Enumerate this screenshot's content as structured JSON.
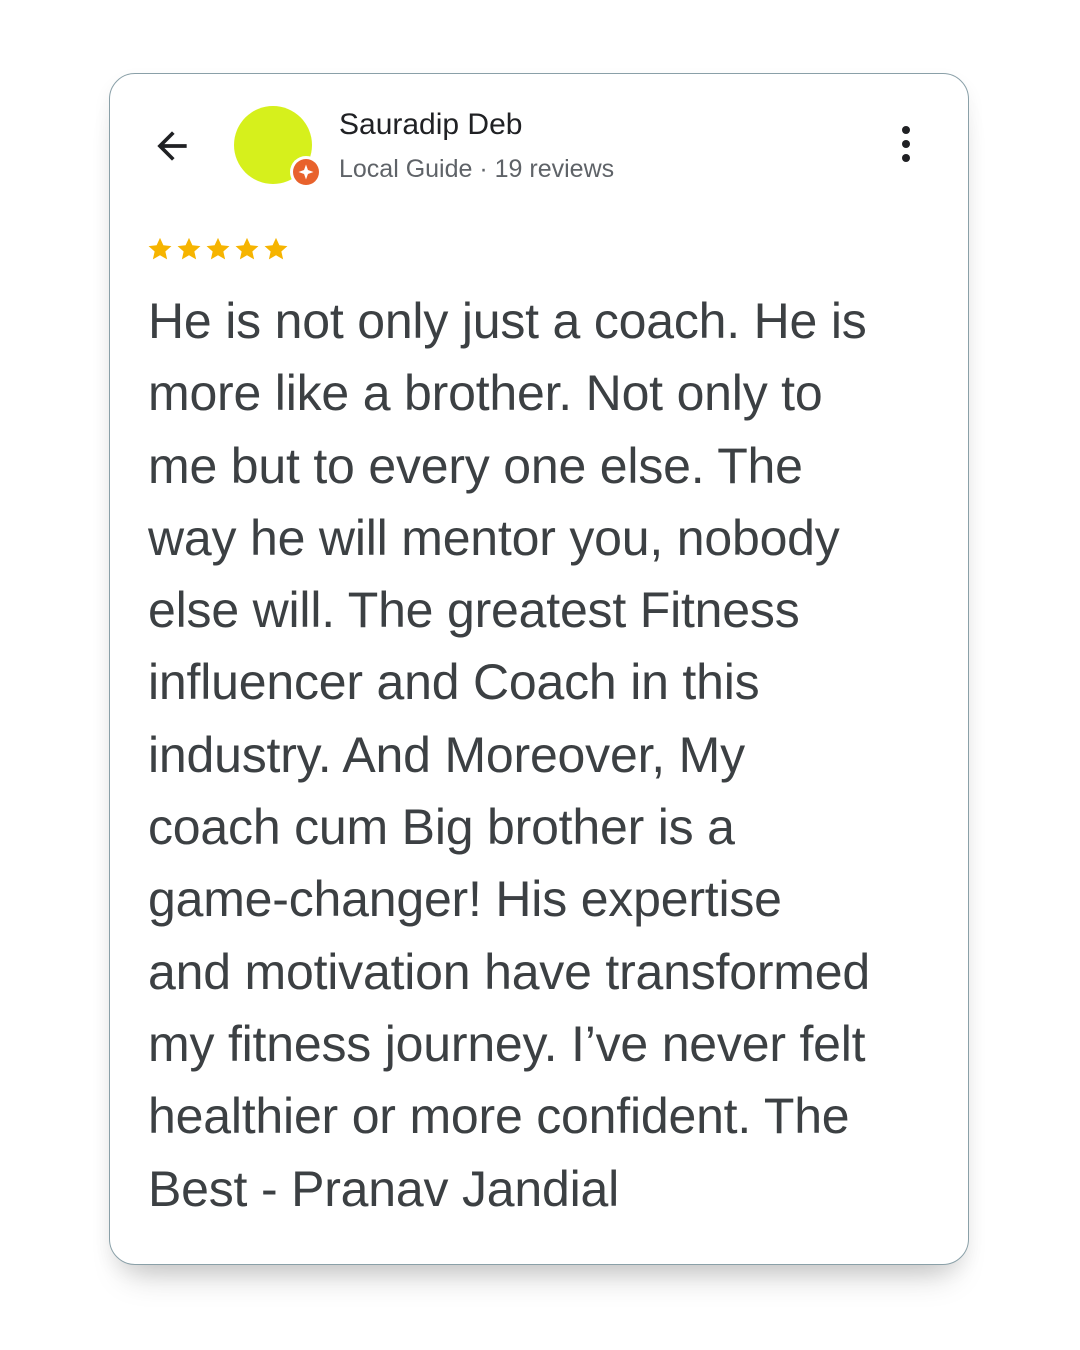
{
  "reviewer": {
    "name": "Sauradip Deb",
    "meta": "Local Guide · 19 reviews",
    "avatar_color": "#d6f01c",
    "badge_color": "#e8622c"
  },
  "rating": {
    "stars": 5,
    "max": 5,
    "star_color": "#f6b400"
  },
  "icons": {
    "back": "arrow-back-icon",
    "more": "more-vertical-icon",
    "badge": "local-guide-badge-icon",
    "star": "star-icon"
  },
  "review": {
    "lines": [
      "He is not only just a coach. He is",
      "more like a brother. Not only to",
      "me but to every one else. The",
      "way he will mentor you, nobody",
      "else will. The greatest Fitness",
      "influencer and Coach in this",
      "industry. And Moreover, My",
      "coach cum Big brother is a",
      "game-changer! His expertise",
      "and motivation have transformed",
      "my fitness journey. I’ve never felt",
      "healthier or more confident. The",
      "Best - Pranav Jandial"
    ]
  }
}
